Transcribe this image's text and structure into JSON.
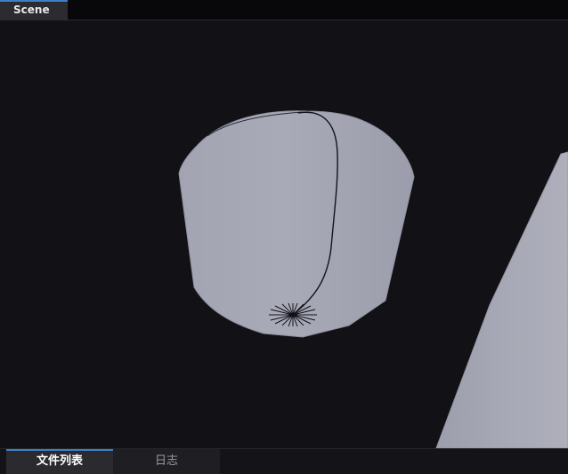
{
  "top_tabs": [
    {
      "label": "Scene",
      "active": true
    }
  ],
  "bottom_tabs": [
    {
      "label": "文件列表",
      "active": true
    },
    {
      "label": "日志",
      "active": false
    }
  ],
  "colors": {
    "accent": "#3d7fc9",
    "viewport_background": "#111116",
    "mesh_fill": "#a4a5b2"
  }
}
